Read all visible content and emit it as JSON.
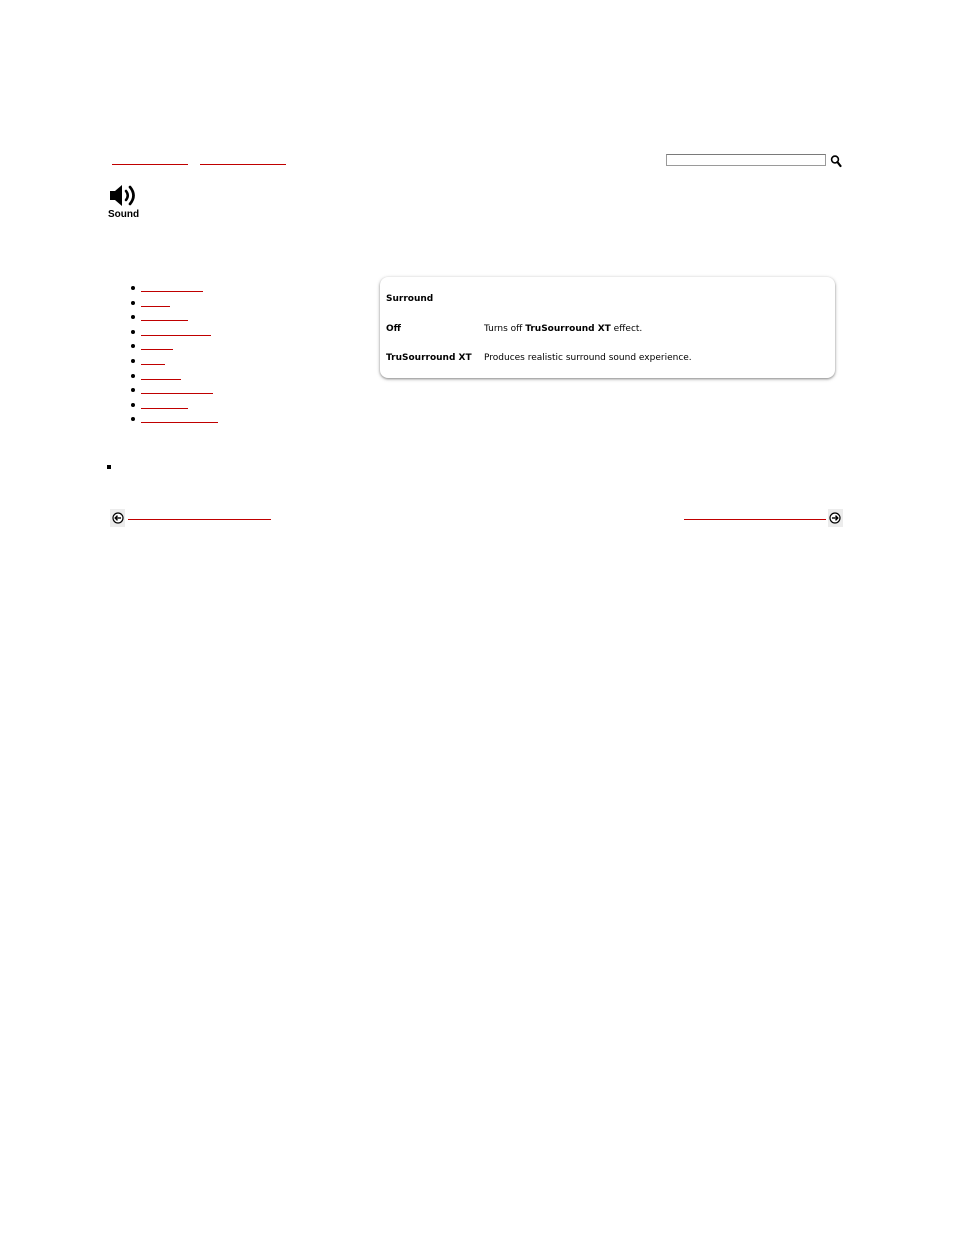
{
  "page": {
    "title": "Sound",
    "icon": "speaker-icon"
  },
  "search": {
    "value": "",
    "placeholder": "",
    "button_icon": "magnifier-icon"
  },
  "panel": {
    "heading": "Surround",
    "rows": [
      {
        "term": "Off",
        "desc_pre": "Turns off ",
        "desc_bold": "TruSourround XT",
        "desc_post": " effect."
      },
      {
        "term": "TruSourround XT",
        "desc_pre": "Produces realistic surround sound experience.",
        "desc_bold": "",
        "desc_post": ""
      }
    ]
  },
  "colors": {
    "link": "#c00000"
  },
  "bottom_nav": {
    "prev_icon": "arrow-left-circle-icon",
    "next_icon": "arrow-right-circle-icon"
  }
}
